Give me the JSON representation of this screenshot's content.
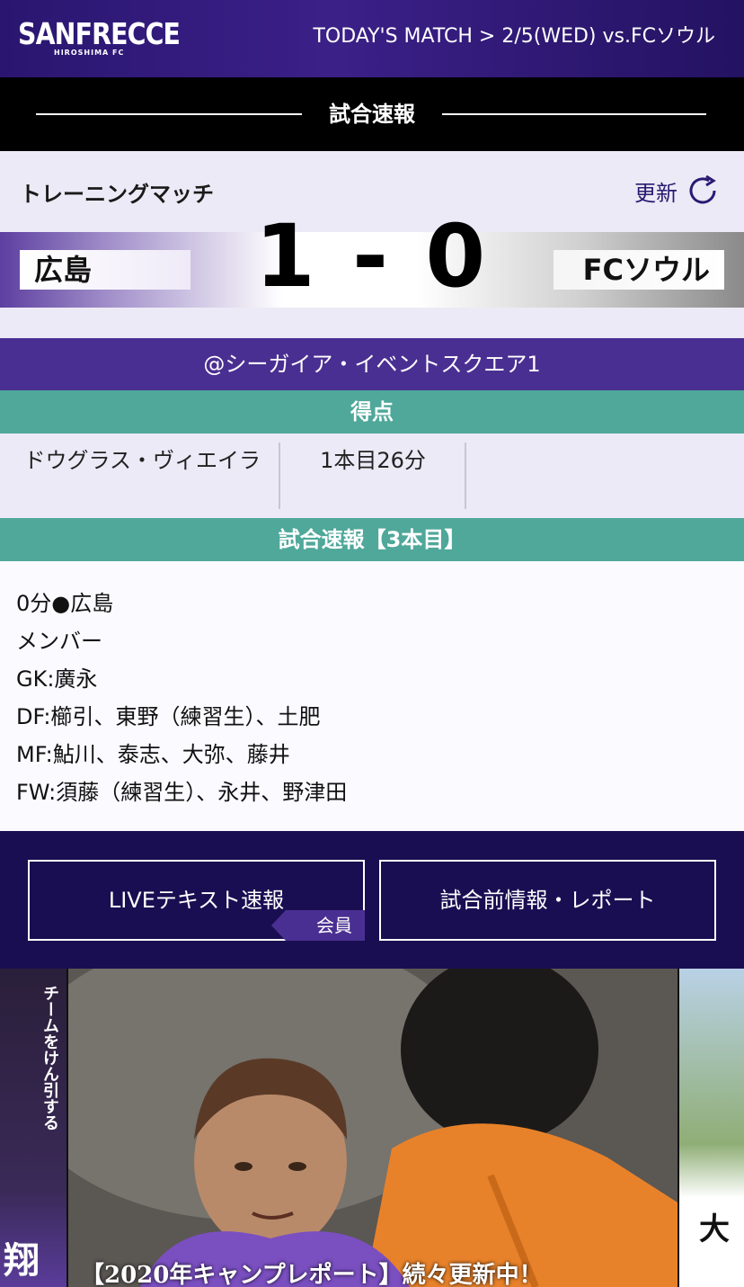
{
  "header": {
    "logo_main": "SANFRECCE",
    "logo_sub": "HIROSHIMA FC",
    "match_link": "TODAY'S MATCH > 2/5(WED) vs.FCソウル"
  },
  "page_title": "試合速報",
  "match": {
    "type": "トレーニングマッチ",
    "refresh_label": "更新",
    "home_team": "広島",
    "away_team": "FCソウル",
    "score": "1 - 0",
    "venue": "@シーガイア・イベントスクエア1"
  },
  "goals": {
    "heading": "得点",
    "rows": [
      {
        "scorer": "ドウグラス・ヴィエイラ",
        "time": "1本目26分",
        "extra": ""
      }
    ]
  },
  "report": {
    "heading": "試合速報【3本目】",
    "lines": [
      "0分●広島",
      "メンバー",
      "GK:廣永",
      "DF:櫛引、東野（練習生）、土肥",
      "MF:鮎川、泰志、大弥、藤井",
      "FW:須藤（練習生）、永井、野津田"
    ]
  },
  "buttons": {
    "live_label": "LIVEテキスト速報",
    "member_tag": "会員",
    "pre_label": "試合前情報・レポート"
  },
  "carousel": {
    "left_text": "チームをけん引する",
    "left_kanji": "翔",
    "main_caption": "【2020年キャンプレポート】続々更新中！",
    "right_text": "大"
  },
  "colors": {
    "brand_purple": "#4a2f92",
    "section_teal": "#4fa89a",
    "footer_navy": "#1a0e52"
  }
}
